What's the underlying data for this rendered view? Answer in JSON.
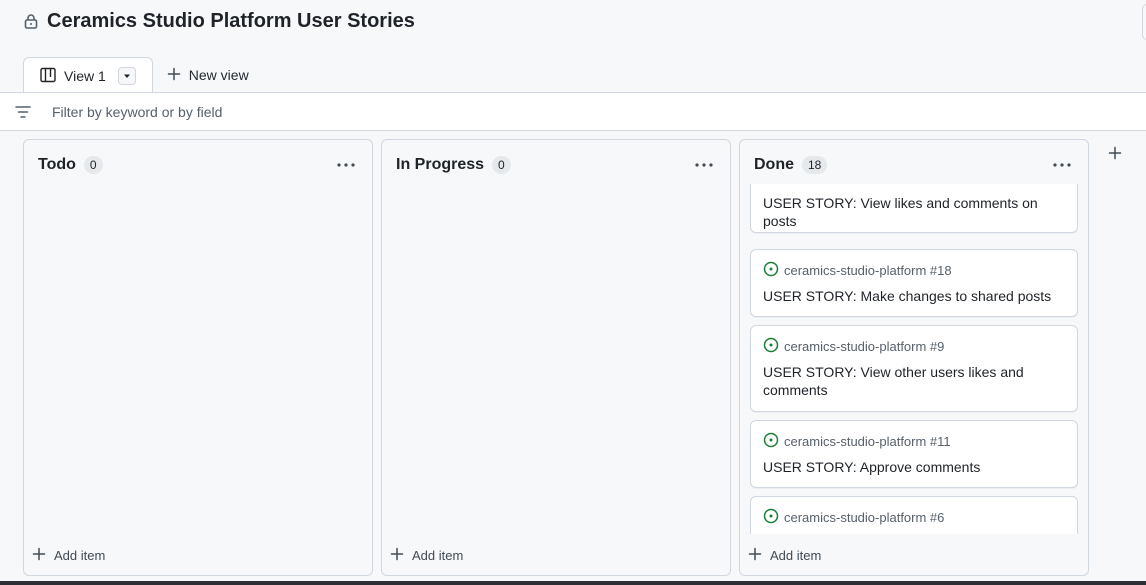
{
  "project": {
    "title": "Ceramics Studio Platform User Stories"
  },
  "tabs": {
    "view_label": "View 1",
    "new_view_label": "New view"
  },
  "filter": {
    "placeholder": "Filter by keyword or by field",
    "value": ""
  },
  "columns": [
    {
      "name": "Todo",
      "count": "0",
      "add_label": "Add item"
    },
    {
      "name": "In Progress",
      "count": "0",
      "add_label": "Add item"
    },
    {
      "name": "Done",
      "count": "18",
      "add_label": "Add item"
    }
  ],
  "done_cards": [
    {
      "meta": "",
      "title": "USER STORY: View likes and comments on posts"
    },
    {
      "meta": "ceramics-studio-platform #18",
      "title": "USER STORY: Make changes to shared posts"
    },
    {
      "meta": "ceramics-studio-platform #9",
      "title": "USER STORY: View other users likes and comments"
    },
    {
      "meta": "ceramics-studio-platform #11",
      "title": "USER STORY: Approve comments"
    },
    {
      "meta": "ceramics-studio-platform #6",
      "title": ""
    }
  ],
  "colors": {
    "open_issue": "#1a7f37",
    "border": "#d0d7de",
    "muted": "#57606a"
  },
  "icons": [
    "lock-icon",
    "board-icon",
    "chevron-down-icon",
    "plus-icon",
    "filter-icon",
    "kebab-icon",
    "issue-open-icon"
  ]
}
